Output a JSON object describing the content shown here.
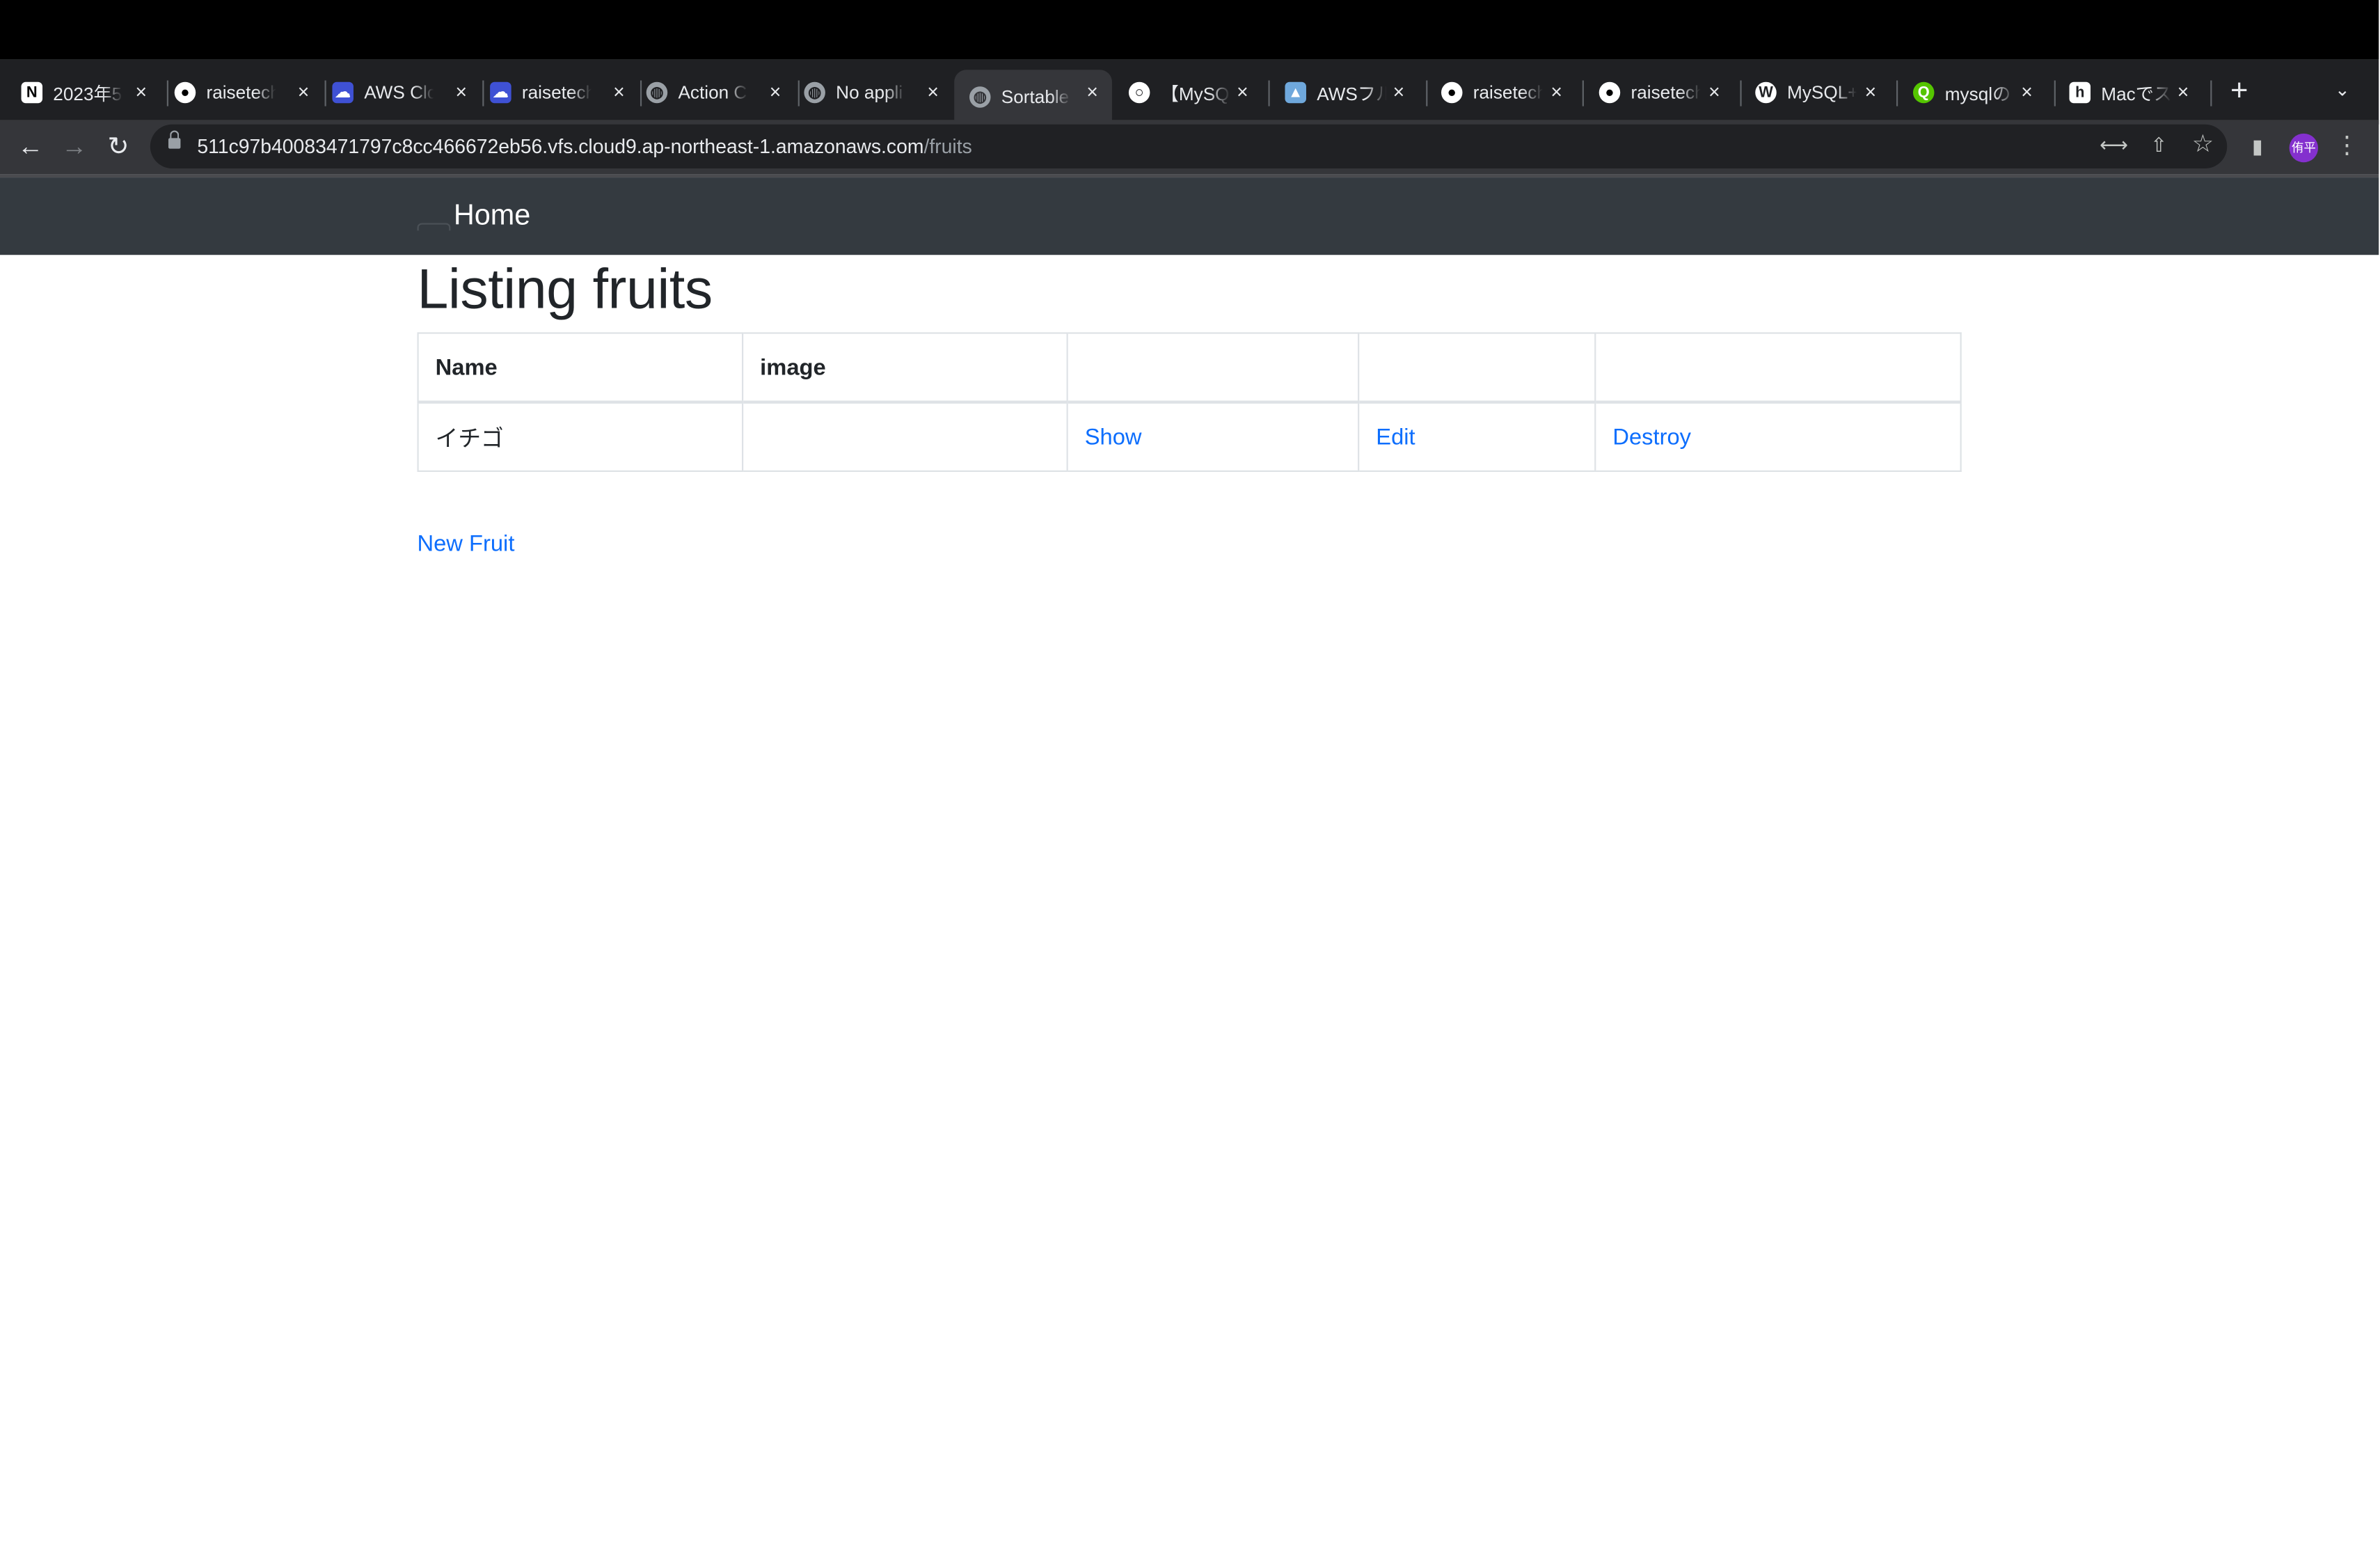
{
  "browser": {
    "tabs": [
      {
        "title": "2023年5",
        "favicon": "notion-icon",
        "favicon_color": "#ffffff"
      },
      {
        "title": "raisetech",
        "favicon": "github-icon",
        "favicon_color": "#ffffff"
      },
      {
        "title": "AWS Clo",
        "favicon": "cloud9-icon",
        "favicon_color": "#3f51d4"
      },
      {
        "title": "raisetech",
        "favicon": "cloud9-icon",
        "favicon_color": "#3f51d4"
      },
      {
        "title": "Action C",
        "favicon": "globe-icon",
        "favicon_color": "#9aa0a6"
      },
      {
        "title": "No appli",
        "favicon": "globe-icon",
        "favicon_color": "#9aa0a6"
      },
      {
        "title": "Sortable",
        "favicon": "globe-icon",
        "favicon_color": "#9aa0a6"
      },
      {
        "title": "【MySQL",
        "favicon": "ring-icon",
        "favicon_color": "#ffffff"
      },
      {
        "title": "AWSフル",
        "favicon": "chart-person-icon",
        "favicon_color": "#6fa8dc"
      },
      {
        "title": "raisetech",
        "favicon": "github-icon",
        "favicon_color": "#ffffff"
      },
      {
        "title": "raisetech",
        "favicon": "github-icon",
        "favicon_color": "#ffffff"
      },
      {
        "title": "MySQL+",
        "favicon": "wordpress-icon",
        "favicon_color": "#ffffff"
      },
      {
        "title": "mysqlの",
        "favicon": "qiita-icon",
        "favicon_color": "#55c500"
      },
      {
        "title": "Macでス",
        "favicon": "hatena-icon",
        "favicon_color": "#ffffff"
      }
    ],
    "active_tab_index": 6,
    "url_host": "511c97b40083471797c8cc466672eb56.vfs.cloud9.ap-northeast-1.amazonaws.com",
    "url_path": "/fruits",
    "profile_initials": "侑平",
    "icons": {
      "back": "←",
      "forward": "→",
      "reload": "↻",
      "translate": "⟷",
      "share": "⇧",
      "star": "☆",
      "sidepanel": "▮",
      "menu": "⋮",
      "new_tab": "+",
      "tab_search": "⌄",
      "close": "×"
    }
  },
  "app": {
    "brand": "Home",
    "heading": "Listing fruits",
    "table": {
      "headers": [
        "Name",
        "image",
        "",
        "",
        ""
      ],
      "rows": [
        {
          "name": "イチゴ",
          "image": "",
          "show": "Show",
          "edit": "Edit",
          "destroy": "Destroy"
        }
      ]
    },
    "new_link": "New Fruit",
    "colors": {
      "navbar": "#343a40",
      "link": "#0d6efd",
      "text": "#212529"
    }
  }
}
